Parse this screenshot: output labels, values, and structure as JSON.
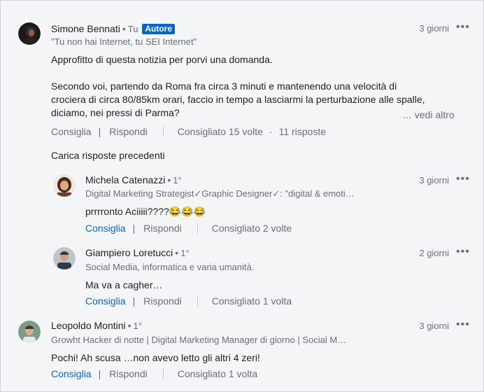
{
  "comments": [
    {
      "author": "Simone Bennati",
      "relation": "Tu",
      "badge": "Autore",
      "headline": "\"Tu non hai Internet, tu SEI Internet\"",
      "time": "3 giorni",
      "lines": [
        "Approfitto di questa notizia per porvi una domanda.",
        "",
        "Secondo voi, partendo da Roma fra circa 3 minuti e mantenendo una velocità di",
        "crociera di circa 80/85km orari, faccio in tempo a lasciarmi la perturbazione alle spalle,",
        "diciamo, nei pressi di Parma?"
      ],
      "see_more": "… vedi altro",
      "like": "Consiglia",
      "reply": "Rispondi",
      "likes_count": "Consigliato 15 volte",
      "replies_count": "11 risposte"
    }
  ],
  "load_previous": "Carica risposte precedenti",
  "replies": [
    {
      "author": "Michela Catenazzi",
      "degree": "1°",
      "headline": "Digital Marketing Strategist✓Graphic Designer✓: \"digital & emoti…",
      "time": "3 giorni",
      "text": "prrrronto Aciiiii????😂😂😂",
      "like": "Consiglia",
      "reply": "Rispondi",
      "likes_count": "Consigliato 2 volte"
    },
    {
      "author": "Giampiero Loretucci",
      "degree": "1°",
      "headline": "Social Media, informatica e varia umanità.",
      "time": "2 giorni",
      "text": "Ma va a cagher…",
      "like": "Consiglia",
      "reply": "Rispondi",
      "likes_count": "Consigliato 1 volta"
    }
  ],
  "comment2": {
    "author": "Leopoldo Montini",
    "degree": "1°",
    "headline": "Growht Hacker di notte | Digital Marketing Manager di giorno | Social M…",
    "time": "3 giorni",
    "text": "Pochi! Ah scusa …non avevo letto gli altri 4 zeri!",
    "like": "Consiglia",
    "reply": "Rispondi",
    "likes_count": "Consigliato 1 volta"
  },
  "icons": {
    "more": "more-horizontal-icon"
  },
  "colors": {
    "accent": "#0a66c2",
    "muted": "#6b6f73",
    "background": "#f3f5f7"
  }
}
